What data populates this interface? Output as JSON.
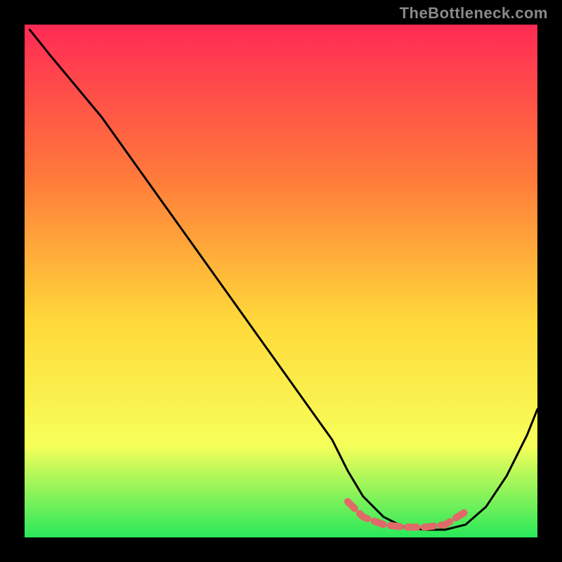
{
  "watermark": "TheBottleneck.com",
  "colors": {
    "background": "#000000",
    "gradient_top": "#ff2a55",
    "gradient_mid1": "#ff7b3a",
    "gradient_mid2": "#ffd93a",
    "gradient_mid3": "#f7ff5a",
    "gradient_bottom": "#29e85a",
    "curve": "#000000",
    "highlight": "#e06a6a"
  },
  "chart_data": {
    "type": "line",
    "title": "",
    "xlabel": "",
    "ylabel": "",
    "xlim": [
      0,
      100
    ],
    "ylim": [
      0,
      100
    ],
    "grid": false,
    "legend": false,
    "series": [
      {
        "name": "bottleneck-curve",
        "x": [
          1,
          5,
          10,
          15,
          20,
          25,
          30,
          35,
          40,
          45,
          50,
          55,
          60,
          63,
          66,
          70,
          74,
          78,
          82,
          86,
          90,
          94,
          98,
          100
        ],
        "y": [
          99,
          94,
          88,
          82,
          75,
          68,
          61,
          54,
          47,
          40,
          33,
          26,
          19,
          13,
          8,
          4,
          2,
          1.5,
          1.5,
          2.5,
          6,
          12,
          20,
          25
        ]
      },
      {
        "name": "optimal-range",
        "x": [
          63,
          66,
          70,
          74,
          78,
          82,
          86
        ],
        "y": [
          7,
          4,
          2.5,
          2,
          2,
          2.5,
          5
        ]
      }
    ],
    "annotations": []
  }
}
